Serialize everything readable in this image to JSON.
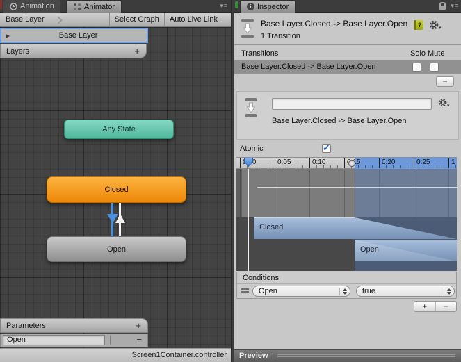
{
  "colors": {
    "selection_blue": "#6ca1e8",
    "timeline_blue": "#6d99da",
    "node_teal": "#4fb79c",
    "node_orange": "#ee8607",
    "node_gray": "#a8a8a8",
    "arrow_blue": "#4a90e0",
    "arrow_white": "#f2f2f2"
  },
  "icons": {
    "menu_caret": "▾",
    "menu_lines": "≡",
    "expand_triangle": "▶",
    "plus": "+",
    "minus": "−",
    "help": "?",
    "info": "i"
  },
  "animator": {
    "tabs": [
      "Animation",
      "Animator"
    ],
    "active_tab": "Animator",
    "breadcrumb": "Base Layer",
    "toolbar_buttons": [
      "Select Graph",
      "Auto Live Link"
    ],
    "layers_panel": {
      "title": "Layers",
      "selected_layer": "Base Layer"
    },
    "graph": {
      "nodes": [
        {
          "label": "Any State",
          "color": "teal"
        },
        {
          "label": "Closed",
          "color": "orange"
        },
        {
          "label": "Open",
          "color": "gray"
        }
      ],
      "transitions": [
        {
          "from": "Closed",
          "to": "Open",
          "selected": true
        },
        {
          "from": "Open",
          "to": "Closed",
          "selected": false
        }
      ]
    },
    "parameters_panel": {
      "title": "Parameters",
      "items": [
        {
          "name": "Open",
          "type": "bool",
          "checked": false
        }
      ]
    },
    "status_bar": "Screen1Container.controller"
  },
  "inspector": {
    "tab": "Inspector",
    "header": {
      "title": "Base Layer.Closed -> Base Layer.Open",
      "subtitle": "1 Transition"
    },
    "transitions": {
      "title": "Transitions",
      "solo_label": "Solo",
      "mute_label": "Mute",
      "rows": [
        {
          "label": "Base Layer.Closed -> Base Layer.Open",
          "solo": false,
          "mute": false
        }
      ]
    },
    "selected_transition": {
      "name_field": "",
      "label": "Base Layer.Closed -> Base Layer.Open"
    },
    "atomic": {
      "label": "Atomic",
      "checked": true
    },
    "timeline": {
      "ticks": [
        "0:00",
        "0:05",
        "0:10",
        "0:15",
        "0:20",
        "0:25",
        "1"
      ],
      "source_label": "Closed",
      "destination_label": "Open"
    },
    "conditions": {
      "title": "Conditions",
      "rows": [
        {
          "parameter": "Open",
          "value": "true"
        }
      ]
    },
    "preview_label": "Preview"
  }
}
